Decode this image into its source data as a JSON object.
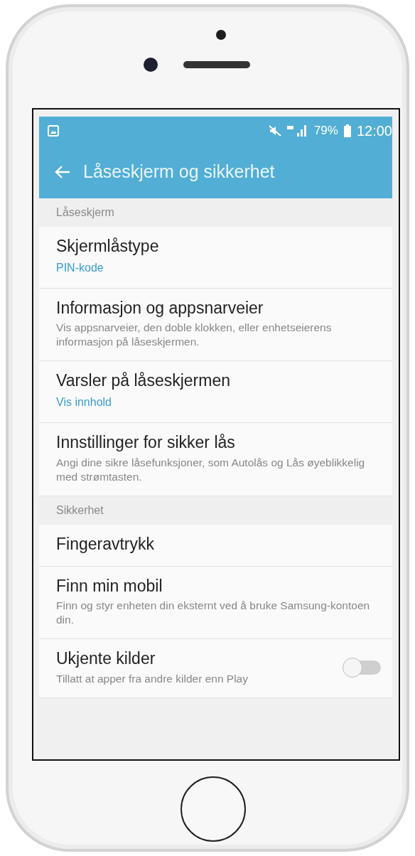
{
  "status_bar": {
    "battery": "79%",
    "time": "12:00"
  },
  "toolbar": {
    "title": "Låseskjerm og sikkerhet"
  },
  "sections": [
    {
      "header": "Låseskjerm",
      "items": [
        {
          "title": "Skjermlåstype",
          "subtitle": "PIN-kode",
          "kind": "value"
        },
        {
          "title": "Informasjon og appsnarveier",
          "subtitle": "Vis appsnarveier, den doble klokken, eller enhetseierens informasjon på låseskjermen.",
          "kind": "description"
        },
        {
          "title": "Varsler på låseskjermen",
          "subtitle": "Vis innhold",
          "kind": "value"
        },
        {
          "title": "Innstillinger for sikker lås",
          "subtitle": "Angi dine sikre låsefunksjoner, som Autolås og Lås øyeblikkelig med strømtasten.",
          "kind": "description"
        }
      ]
    },
    {
      "header": "Sikkerhet",
      "items": [
        {
          "title": "Fingeravtrykk",
          "kind": "plain"
        },
        {
          "title": "Finn min mobil",
          "subtitle": "Finn og styr enheten din eksternt ved å bruke Samsung-kontoen din.",
          "kind": "description"
        },
        {
          "title": "Ukjente kilder",
          "subtitle": "Tillatt at apper fra andre kilder enn Play",
          "kind": "toggle",
          "on": false
        }
      ]
    }
  ]
}
